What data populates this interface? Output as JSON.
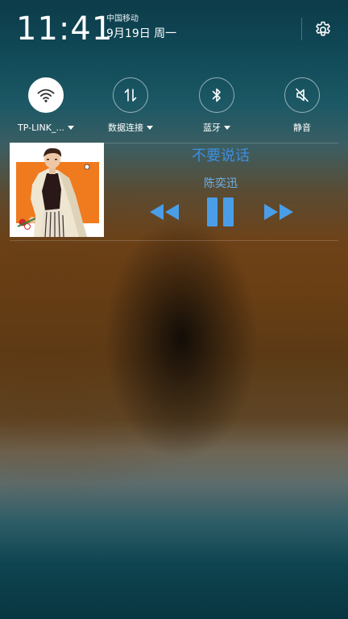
{
  "status": {
    "time": "11:41",
    "carrier": "中国移动",
    "date": "9月19日 周一"
  },
  "icons": {
    "settings": "gear-icon",
    "wifi": "wifi-icon",
    "data": "data-transfer-icon",
    "bluetooth": "bluetooth-icon",
    "mute": "speaker-muted-icon",
    "prev": "rewind-icon",
    "pause": "pause-icon",
    "next": "fast-forward-icon"
  },
  "toggles": [
    {
      "label": "TP-LINK_...",
      "active": true,
      "has_dropdown": true
    },
    {
      "label": "数据连接",
      "active": false,
      "has_dropdown": true
    },
    {
      "label": "蓝牙",
      "active": false,
      "has_dropdown": true
    },
    {
      "label": "静音",
      "active": false,
      "has_dropdown": false
    }
  ],
  "player": {
    "title": "不要说话",
    "artist": "陈奕迅",
    "state": "playing"
  },
  "colors": {
    "accent_blue": "#3d8ee0",
    "control_blue": "#4a9ee8",
    "album_orange": "#f07a1e"
  }
}
